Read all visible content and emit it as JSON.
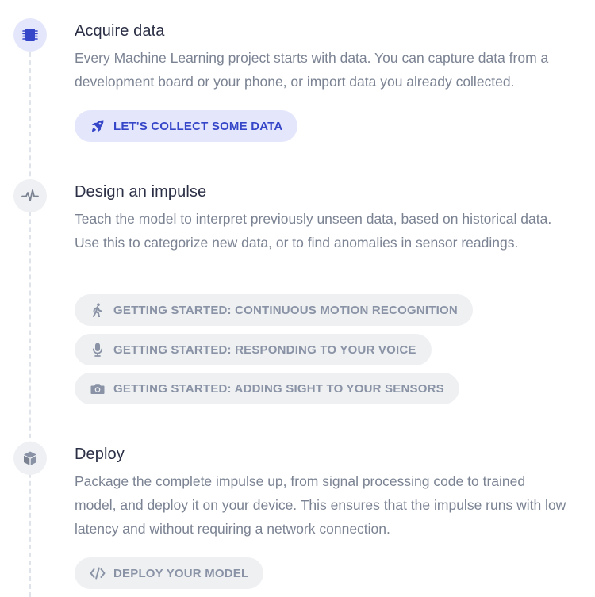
{
  "steps": [
    {
      "title": "Acquire data",
      "description": "Every Machine Learning project starts with data. You can capture data from a development board or your phone, or import data you already collected.",
      "icon": "chip-icon",
      "buttons": [
        {
          "label": "LET'S COLLECT SOME DATA",
          "icon": "rocket-icon",
          "style": "primary"
        }
      ]
    },
    {
      "title": "Design an impulse",
      "description": "Teach the model to interpret previously unseen data, based on historical data. Use this to categorize new data, or to find anomalies in sensor readings.",
      "icon": "waveform-icon",
      "buttons": [
        {
          "label": "GETTING STARTED: CONTINUOUS MOTION RECOGNITION",
          "icon": "walking-icon",
          "style": "secondary"
        },
        {
          "label": "GETTING STARTED: RESPONDING TO YOUR VOICE",
          "icon": "microphone-icon",
          "style": "secondary"
        },
        {
          "label": "GETTING STARTED: ADDING SIGHT TO YOUR SENSORS",
          "icon": "camera-icon",
          "style": "secondary"
        }
      ]
    },
    {
      "title": "Deploy",
      "description": "Package the complete impulse up, from signal processing code to trained model, and deploy it on your device. This ensures that the impulse runs with low latency and without requiring a network connection.",
      "icon": "cube-icon",
      "buttons": [
        {
          "label": "DEPLOY YOUR MODEL",
          "icon": "code-icon",
          "style": "secondary"
        }
      ]
    }
  ],
  "colors": {
    "primary_accent": "#3646c8",
    "primary_bg": "#e4e7fb",
    "secondary_text": "#8a93a6",
    "secondary_bg": "#eef0f2"
  }
}
